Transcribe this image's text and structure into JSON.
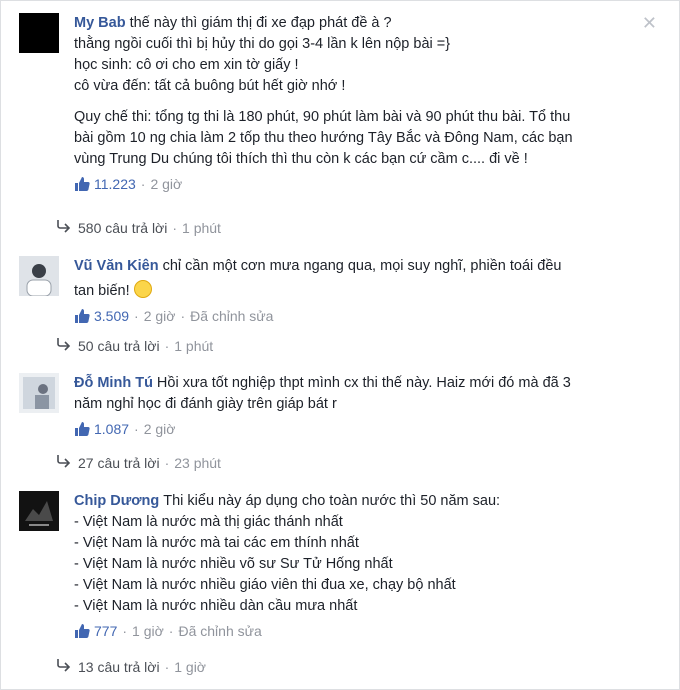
{
  "comments": [
    {
      "author": "My Bab",
      "lines": [
        "thế này thì giám thị đi xe đạp phát đề à ?",
        "thằng ngồi cuối thì bị hủy thi do gọi 3-4 lần k lên nộp bài =}",
        "học sinh: cô ơi cho em xin tờ giấy !",
        "cô vừa đến: tất cả buông bút hết giờ nhớ !"
      ],
      "lines2": [
        "Quy chế thi: tổng tg thi là 180 phút, 90 phút làm bài và 90 phút thu bài. Tổ thu",
        "bài gồm 10 ng chia làm 2 tốp thu theo hướng Tây Bắc và Đông Nam, các bạn",
        "vùng Trung Du chúng tôi thích thì thu còn k các bạn cứ cầm c.... đi về !"
      ],
      "likes": "11.223",
      "time": "2 giờ",
      "replies": "580 câu trả lời",
      "reply_time": "1 phút"
    },
    {
      "author": "Vũ Văn Kiên",
      "lines": [
        "chỉ cần một cơn mưa ngang qua, mọi suy nghĩ, phiền toái đều",
        "tan biến!"
      ],
      "likes": "3.509",
      "time": "2 giờ",
      "edited": "Đã chỉnh sửa",
      "replies": "50 câu trả lời",
      "reply_time": "1 phút"
    },
    {
      "author": "Đỗ Minh Tú",
      "lines": [
        "Hồi xưa tốt nghiệp thpt mình cx thi thế này. Haiz mới đó mà đã 3",
        "năm nghỉ học đi đánh giày trên giáp bát r"
      ],
      "likes": "1.087",
      "time": "2 giờ",
      "replies": "27 câu trả lời",
      "reply_time": "23 phút"
    },
    {
      "author": "Chip Dương",
      "lines": [
        "Thi kiểu này áp dụng cho toàn nước thì 50 năm sau:",
        "- Việt Nam là nước mà thị giác thánh nhất",
        "- Việt Nam là nước mà tai các em thính nhất",
        "- Việt Nam là nước nhiều võ sư Sư Tử Hống nhất",
        "- Việt Nam là nước nhiều giáo viên thi đua xe, chạy bộ nhất",
        "- Việt Nam là nước nhiều dàn cầu mưa nhất"
      ],
      "likes": "777",
      "time": "1 giờ",
      "edited": "Đã chỉnh sửa",
      "replies": "13 câu trả lời",
      "reply_time": "1 giờ"
    }
  ],
  "close_icon": "close-icon",
  "accent": "#365899",
  "like_color": "#4267b2"
}
